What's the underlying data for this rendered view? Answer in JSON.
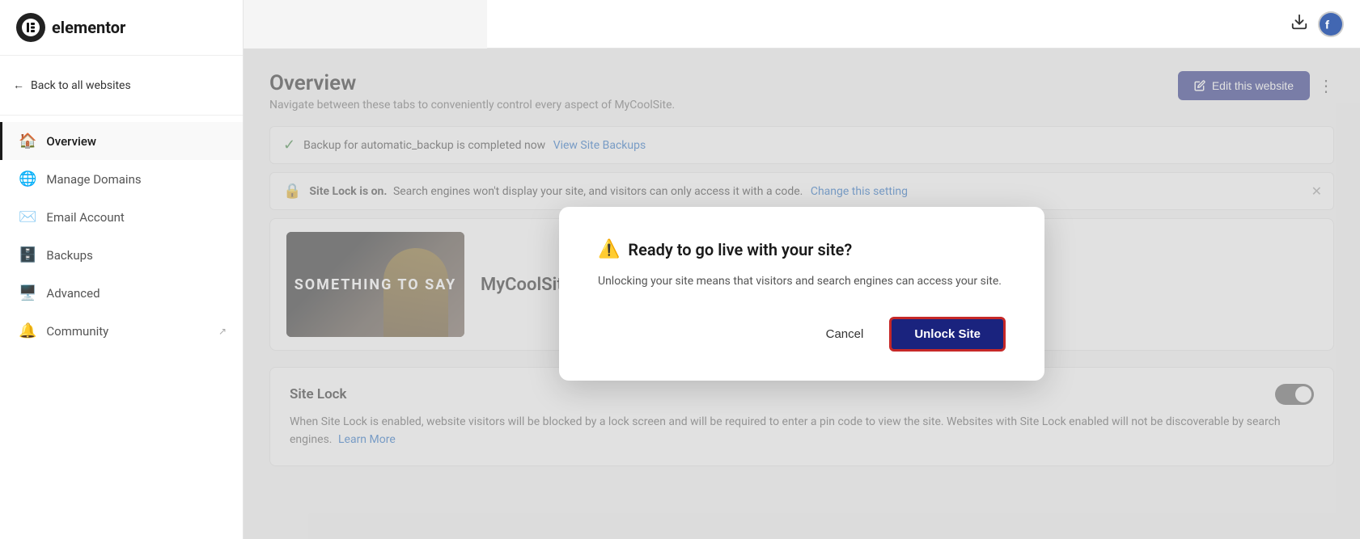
{
  "app": {
    "logo_text": "elementor",
    "logo_icon": "E"
  },
  "sidebar": {
    "back_label": "Back to all websites",
    "items": [
      {
        "id": "overview",
        "label": "Overview",
        "icon": "🏠",
        "active": true,
        "external": false
      },
      {
        "id": "manage-domains",
        "label": "Manage Domains",
        "icon": "🌐",
        "active": false,
        "external": false
      },
      {
        "id": "email-account",
        "label": "Email Account",
        "icon": "✉️",
        "active": false,
        "external": false
      },
      {
        "id": "backups",
        "label": "Backups",
        "icon": "🗄️",
        "active": false,
        "external": false
      },
      {
        "id": "advanced",
        "label": "Advanced",
        "icon": "🖥️",
        "active": false,
        "external": false
      },
      {
        "id": "community",
        "label": "Community",
        "icon": "🔔",
        "active": false,
        "external": true
      }
    ]
  },
  "header": {
    "page_title": "Overview",
    "page_subtitle": "Navigate between these tabs to conveniently control every aspect of MyCoolSite.",
    "edit_button_label": "Edit this website"
  },
  "alerts": [
    {
      "id": "backup-alert",
      "icon": "✅",
      "text": "Backup for automatic_backup is completed now",
      "link_text": "View Site Backups",
      "closable": false
    },
    {
      "id": "sitelock-alert",
      "icon": "🔒",
      "text": "Site Lock is on. Search engines won't display your site, and visitors can only access it with a code.",
      "link_text": "Change this setting",
      "closable": true
    }
  ],
  "site": {
    "name": "MyCoolSite",
    "thumbnail_text": "SOMETHING TO SAY"
  },
  "site_lock_section": {
    "title": "Site Lock",
    "body": "When Site Lock is enabled, website visitors will be blocked by a lock screen and will be required to enter a pin code to view the site. Websites with Site Lock enabled will not be discoverable by search engines.",
    "learn_more_label": "Learn More",
    "toggle_on": true
  },
  "dialog": {
    "title": "Ready to go live with your site?",
    "warning_icon": "⚠️",
    "body": "Unlocking your site means that visitors and search engines can access your site.",
    "cancel_label": "Cancel",
    "confirm_label": "Unlock Site"
  }
}
